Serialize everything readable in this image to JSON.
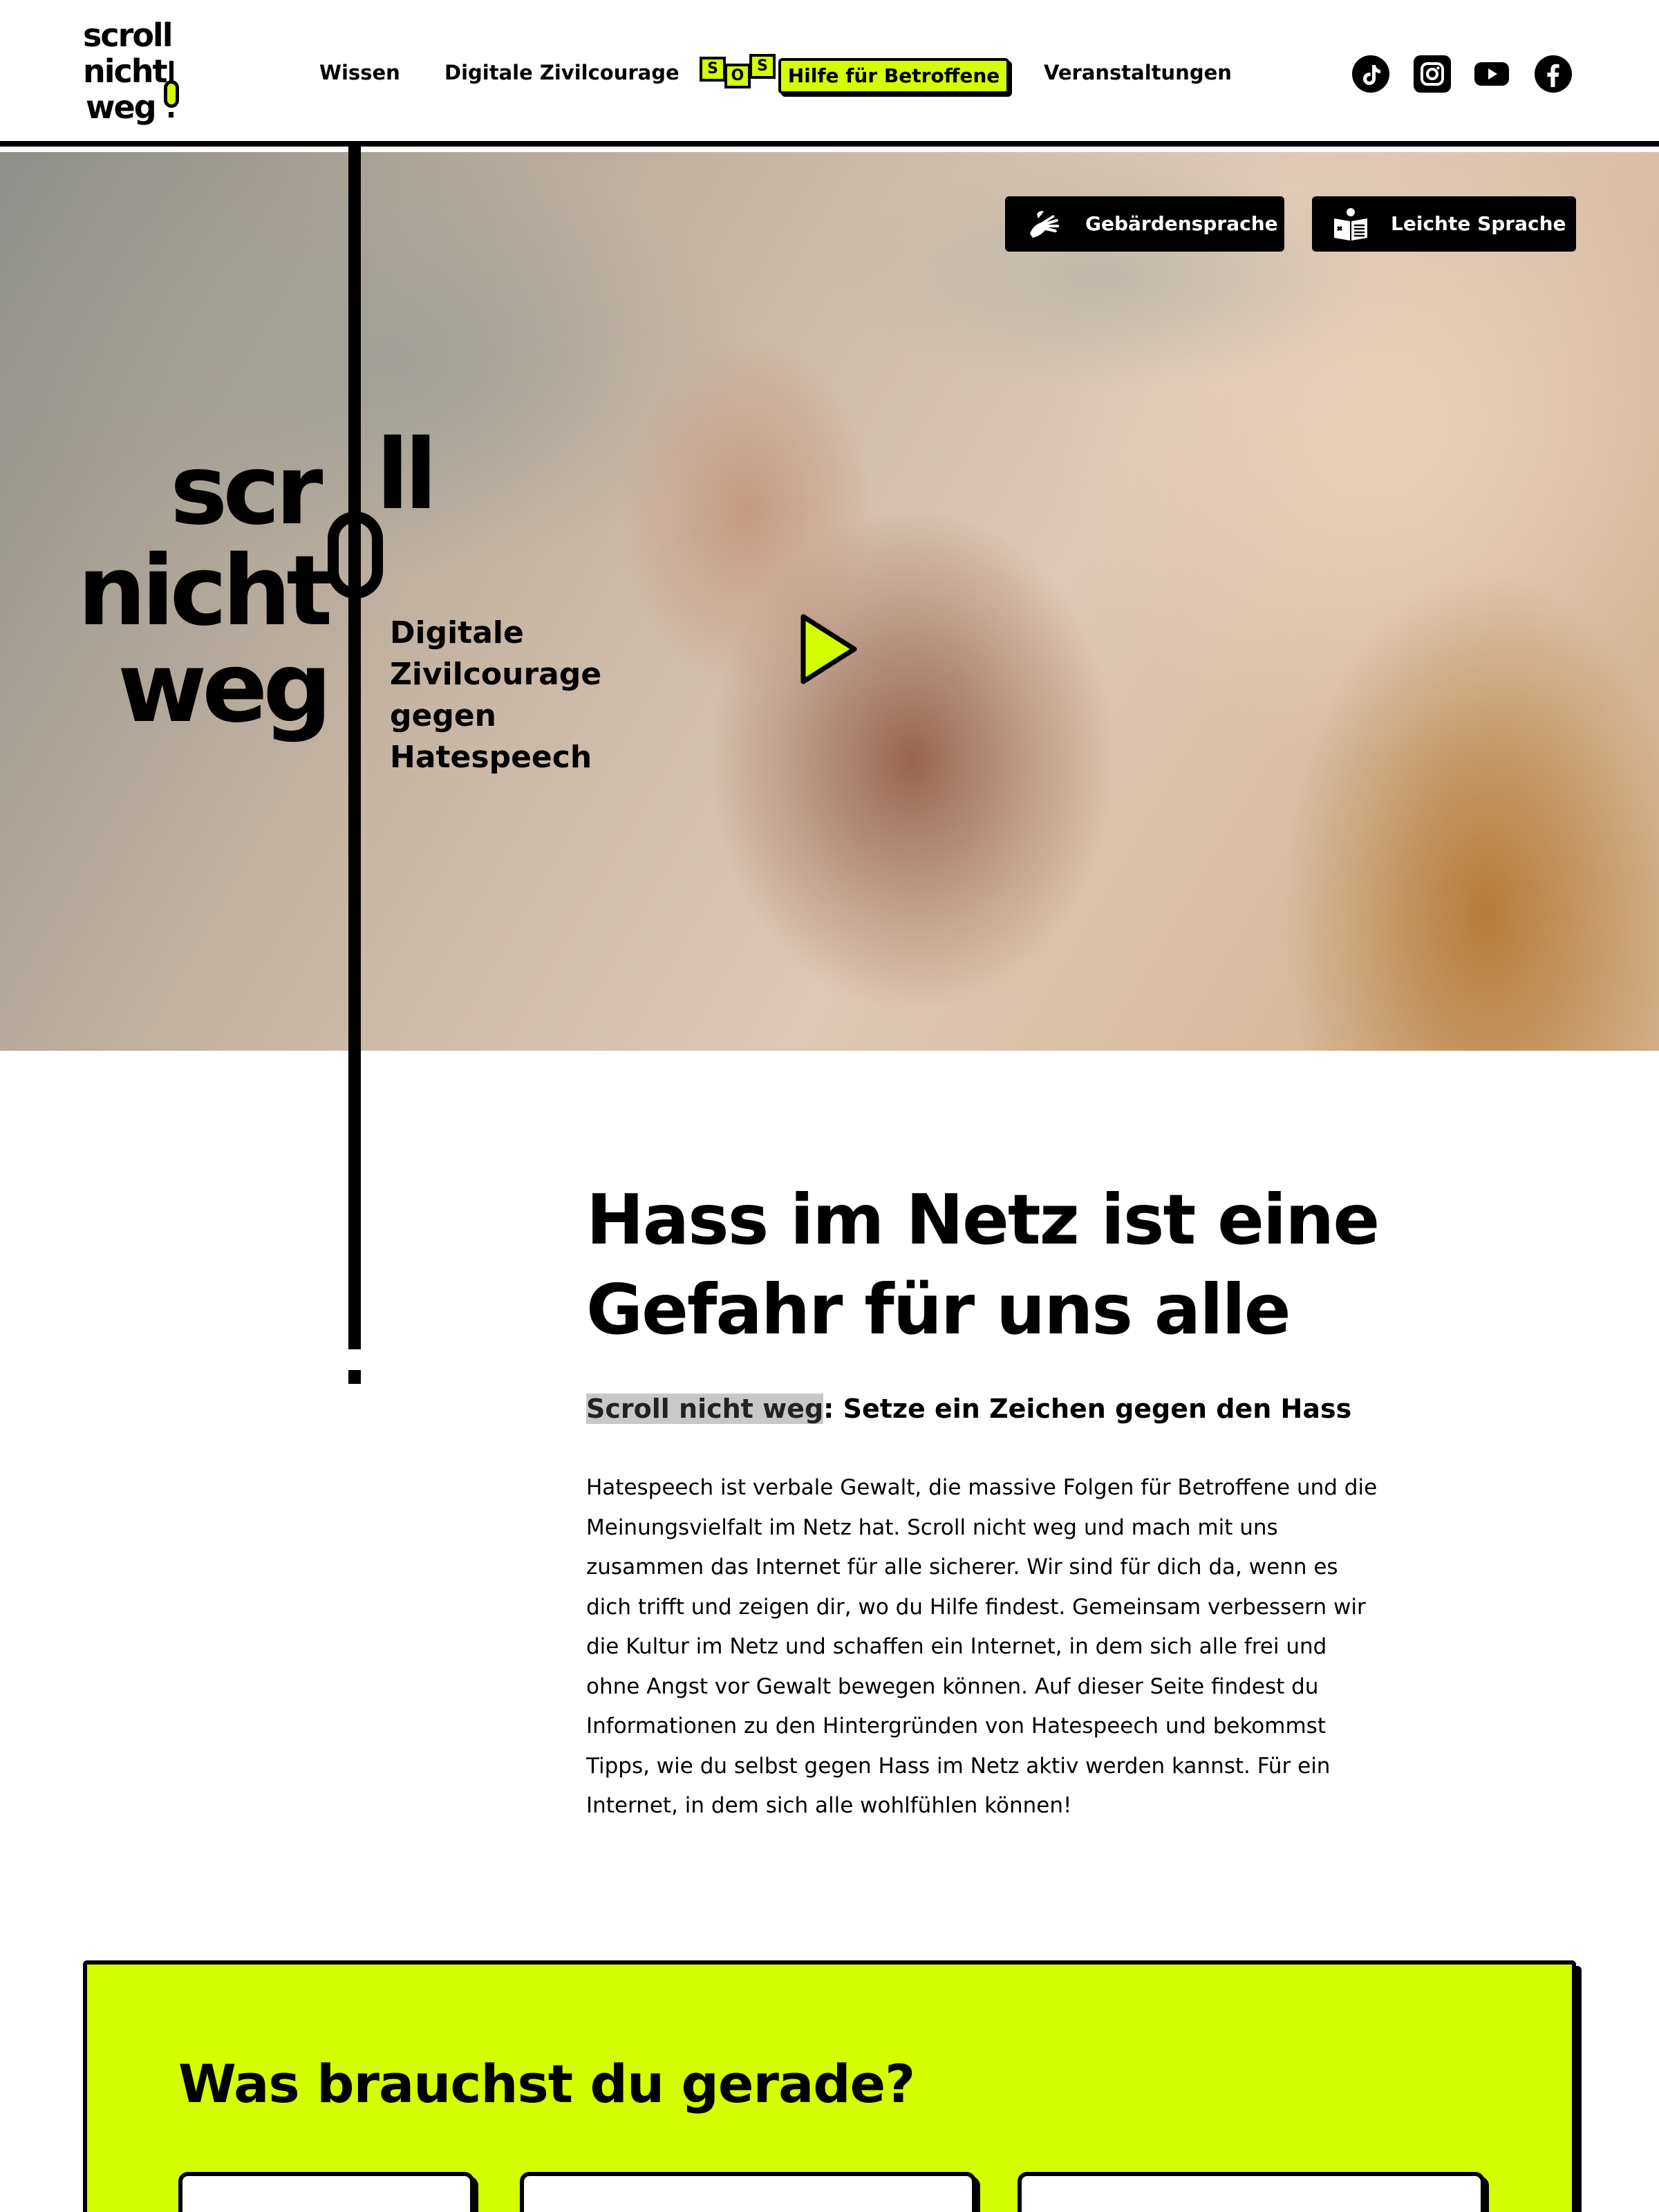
{
  "colors": {
    "accent": "#d4ff00",
    "text": "#000000",
    "background": "#ffffff",
    "highlight": "#c8c8c8"
  },
  "header": {
    "logo": {
      "line1": "scroll",
      "line2": "nicht",
      "line3": "weg"
    },
    "nav": {
      "wissen": "Wissen",
      "digitale_zivilcourage": "Digitale Zivilcourage",
      "sos_letters": [
        "S",
        "O",
        "S"
      ],
      "hilfe": "Hilfe für Betroffene",
      "veranstaltungen": "Veranstaltungen"
    },
    "social_icons": [
      "tiktok-icon",
      "instagram-icon",
      "youtube-icon",
      "facebook-icon"
    ]
  },
  "hero": {
    "btn_gebaerden": "Gebärdensprache",
    "btn_leichte": "Leichte Sprache",
    "logo_scr": "scr",
    "logo_ll": "ll",
    "logo_nicht": "nicht",
    "logo_weg": "weg",
    "tagline": [
      "Digitale",
      "Zivilcourage",
      "gegen",
      "Hatespeech"
    ]
  },
  "intro": {
    "title_line1": "Hass im Netz ist eine",
    "title_line2": "Gefahr für uns alle",
    "subtitle_highlight": "Scroll nicht weg",
    "subtitle_rest": ": Setze ein Zeichen gegen den Hass",
    "body_lines": [
      "Hatespeech ist verbale Gewalt, die massive Folgen für Betroffene und die",
      "Meinungsvielfalt im Netz hat. Scroll nicht weg und mach mit uns",
      "zusammen das Internet für alle sicherer. Wir sind für dich da, wenn es",
      "dich trifft und zeigen dir, wo du Hilfe findest. Gemeinsam verbessern wir",
      "die Kultur im Netz und schaffen ein Internet, in dem sich alle frei und",
      "ohne Angst vor Gewalt bewegen können. Auf dieser Seite findest du",
      "Informationen zu den Hintergründen von Hatespeech und bekommst",
      "Tipps, wie du selbst gegen Hass im Netz aktiv werden kannst. Für ein",
      "Internet, in dem sich alle wohlfühlen können!"
    ]
  },
  "help": {
    "title": "Was brauchst du gerade?"
  }
}
